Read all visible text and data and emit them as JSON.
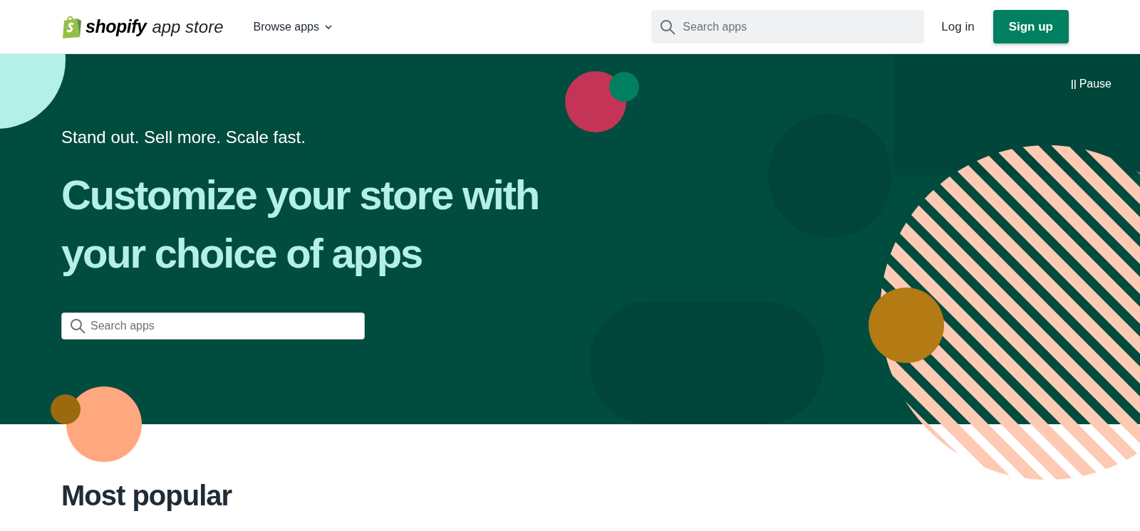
{
  "header": {
    "logo": {
      "brand": "shopify",
      "suffix": "app store"
    },
    "browse_menu": {
      "label": "Browse apps",
      "expanded": false
    },
    "search": {
      "placeholder": "Search apps"
    },
    "login": "Log in",
    "signup": "Sign up"
  },
  "hero": {
    "pause": {
      "label": "Pause"
    },
    "tagline": "Stand out. Sell more. Scale fast.",
    "headline": "Customize your store with your choice of apps",
    "search": {
      "placeholder": "Search apps"
    }
  },
  "section": {
    "title": "Most popular"
  }
}
